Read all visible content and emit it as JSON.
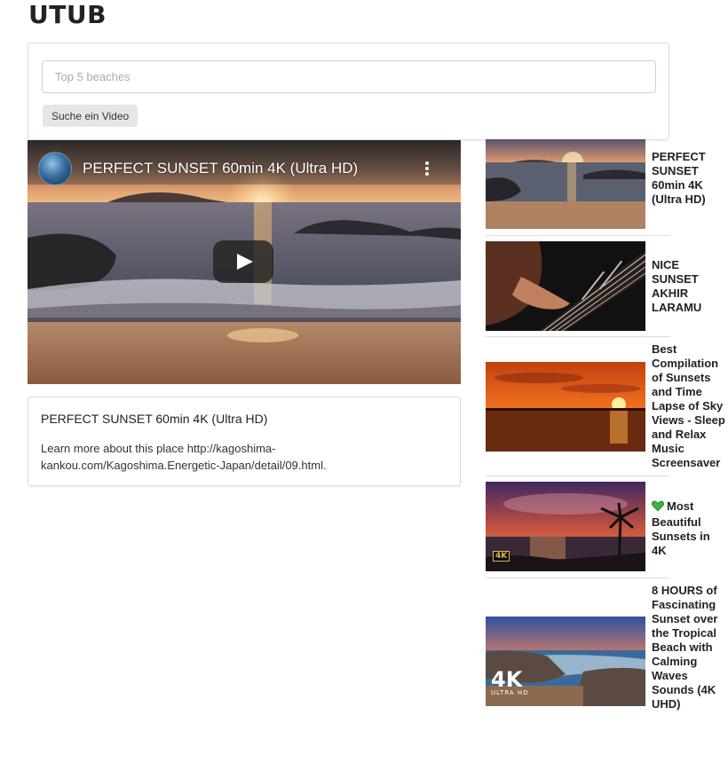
{
  "app": {
    "title": "UTUB"
  },
  "search": {
    "placeholder": "Top 5 beaches",
    "value": "",
    "button_label": "Suche ein Video"
  },
  "player": {
    "title": "PERFECT SUNSET 60min 4K (Ultra HD)",
    "menu_icon": "more-vert-icon",
    "play_icon": "play-icon"
  },
  "detail": {
    "title": "PERFECT SUNSET 60min 4K (Ultra HD)",
    "description": "Learn more about this place http://kagoshima-kankou.com/Kagoshima.Energetic-Japan/detail/09.html."
  },
  "sidebar": {
    "videos": [
      {
        "title": "PERFECT SUNSET 60min 4K (Ultra HD)"
      },
      {
        "title": "NICE SUNSET AKHIR LARAMU"
      },
      {
        "title": "Best Compilation of Sunsets and Time Lapse of Sky Views - Sleep and Relax Music Screensaver"
      },
      {
        "title": "Most Beautiful Sunsets in 4K",
        "icon": "green-heart-icon",
        "badge": "4K"
      },
      {
        "title": "8 HOURS of Fascinating Sunset over the Tropical Beach with Calming Waves Sounds (4K UHD)",
        "logo_big": "4K",
        "logo_small": "ULTRA HD"
      }
    ]
  },
  "colors": {
    "heart": "#3cb043",
    "badge": "#e0b84a",
    "card_border": "#dddddd"
  }
}
